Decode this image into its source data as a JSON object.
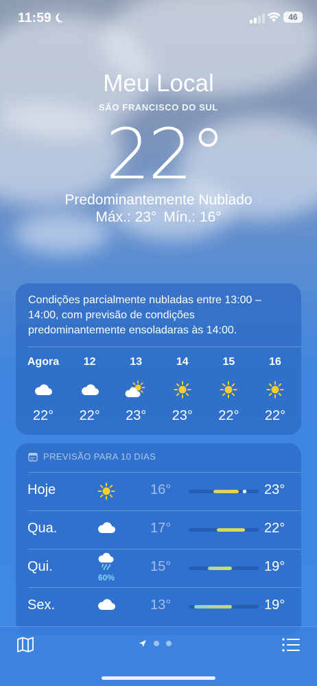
{
  "status_bar": {
    "time": "11:59",
    "battery": "46"
  },
  "header": {
    "location": "Meu Local",
    "sublocation": "SÃO FRANCISCO DO SUL",
    "temperature": "22°",
    "condition": "Predominantemente Nublado",
    "high": "Máx.: 23°",
    "low": "Mín.: 16°"
  },
  "hourly": {
    "summary": "Condições parcialmente nubladas entre 13:00 – 14:00, com previsão de condições predominantemente ensoladaras às 14:00.",
    "hours": [
      {
        "label": "Agora",
        "icon": "cloud-icon",
        "temp": "22°"
      },
      {
        "label": "12",
        "icon": "cloud-icon",
        "temp": "22°"
      },
      {
        "label": "13",
        "icon": "partly-sunny-icon",
        "temp": "23°"
      },
      {
        "label": "14",
        "icon": "sun-icon",
        "temp": "23°"
      },
      {
        "label": "15",
        "icon": "sun-icon",
        "temp": "22°"
      },
      {
        "label": "16",
        "icon": "sun-icon",
        "temp": "22°"
      }
    ]
  },
  "daily": {
    "header": "PREVISÃO PARA 10 DIAS",
    "days": [
      {
        "name": "Hoje",
        "icon": "sun-icon",
        "precip": "",
        "low": "16°",
        "high": "23°",
        "bar_start": 0.35,
        "bar_end": 0.72,
        "current": 0.8,
        "color_start": "#c8d86a",
        "color_end": "#f3d23c"
      },
      {
        "name": "Qua.",
        "icon": "cloud-icon",
        "precip": "",
        "low": "17°",
        "high": "22°",
        "bar_start": 0.4,
        "bar_end": 0.8,
        "current": null,
        "color_start": "#d7d95a",
        "color_end": "#e9d84a"
      },
      {
        "name": "Qui.",
        "icon": "rain-icon",
        "precip": "60%",
        "low": "15°",
        "high": "19°",
        "bar_start": 0.27,
        "bar_end": 0.62,
        "current": null,
        "color_start": "#a7dba0",
        "color_end": "#d6da5e"
      },
      {
        "name": "Sex.",
        "icon": "cloud-icon",
        "precip": "",
        "low": "13°",
        "high": "19°",
        "bar_start": 0.08,
        "bar_end": 0.62,
        "current": null,
        "color_start": "#8fd3c9",
        "color_end": "#c9d96a"
      }
    ]
  },
  "colors": {
    "sun": "#f8cf2a",
    "accent_blue": "#3f8ae6"
  }
}
